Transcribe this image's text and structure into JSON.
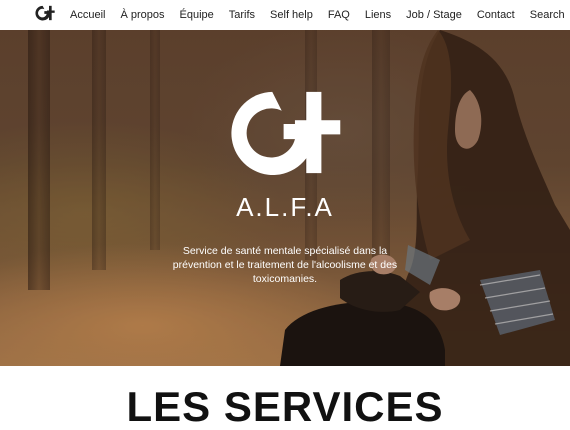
{
  "nav": {
    "logo_icon": "alfa-logo-icon",
    "items": [
      {
        "label": "Accueil"
      },
      {
        "label": "À propos"
      },
      {
        "label": "Équipe"
      },
      {
        "label": "Tarifs"
      },
      {
        "label": "Self help"
      },
      {
        "label": "FAQ"
      },
      {
        "label": "Liens"
      },
      {
        "label": "Job / Stage"
      },
      {
        "label": "Contact"
      },
      {
        "label": "Search"
      }
    ]
  },
  "hero": {
    "logo_icon": "alfa-logo-icon",
    "title": "A.L.F.A",
    "subtitle": "Service de santé mentale spécialisé dans la prévention et le traitement de l'alcoolisme et des toxicomanies."
  },
  "services": {
    "title": "LES SERVICES"
  },
  "colors": {
    "text_dark": "#111111",
    "nav_text": "#222222",
    "hero_text": "#ffffff"
  }
}
